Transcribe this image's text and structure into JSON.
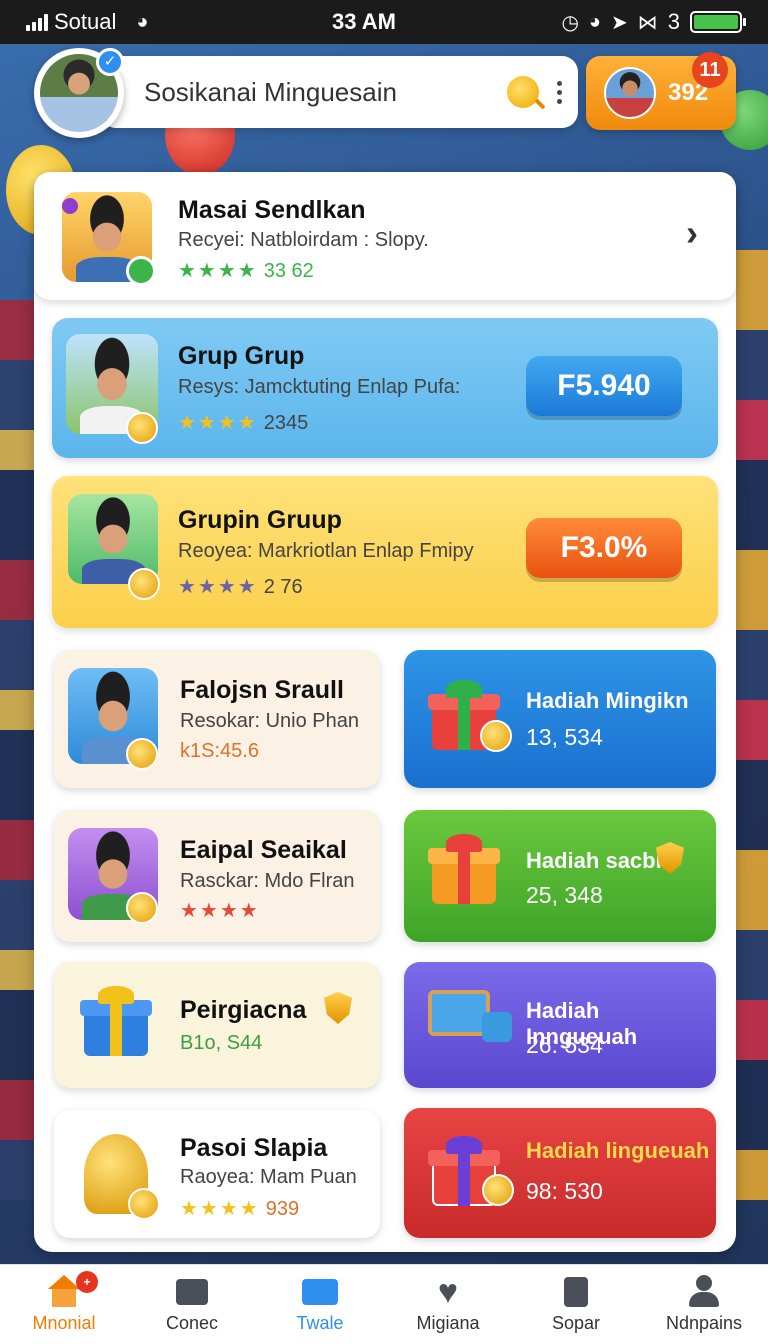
{
  "status_bar": {
    "carrier": "Sotual",
    "time": "33 AM",
    "battery_level_text": "3"
  },
  "header": {
    "search_text": "Sosikanai Minguesain",
    "coin_amount": "392",
    "notification_count": "11"
  },
  "featured": {
    "title": "Masai Sendlkan",
    "subtitle": "Recyei: Natbloirdam : Slopy.",
    "stars": "★★★★",
    "count": "33 62"
  },
  "groups": [
    {
      "title": "Grup Grup",
      "subtitle": "Resys: Jamcktuting Enlap Pufa:",
      "stars": "★★★★",
      "count": "2345",
      "price": "F5.940"
    },
    {
      "title": "Grupin Gruup",
      "subtitle": "Reoyea: Markriotlan Enlap Fmipy",
      "stars": "★★★★",
      "count": "2 76",
      "price": "F3.0%"
    }
  ],
  "players": [
    {
      "title": "Falojsn Sraull",
      "subtitle": "Resokar: Unio Phan",
      "extra": "k1S:45.6"
    },
    {
      "title": "Eaipal Seaikal",
      "subtitle": "Rasckar: Mdo Flran",
      "extra": "★★★★"
    },
    {
      "title": "Peirgiacna",
      "subtitle": "",
      "extra": "B1o, S44"
    },
    {
      "title": "Pasoi Slapia",
      "subtitle": "Raoyea: Mam Puan",
      "extra": "★★★★",
      "count": "939"
    }
  ],
  "prizes": [
    {
      "title": "Hadiah Mingikn",
      "value": "13, 534",
      "color": "#1f7fd6"
    },
    {
      "title": "Hadiah sacbi",
      "value": "25, 348",
      "color": "#4db72e"
    },
    {
      "title": "Hadiah Inngueuah",
      "value": "26: 534",
      "color": "#6a55d6"
    },
    {
      "title": "Hadiah lingueuah",
      "value": "98: 530",
      "color": "#d93636"
    }
  ],
  "nav": [
    {
      "label": "Mnonial",
      "icon": "home-icon"
    },
    {
      "label": "Conec",
      "icon": "puzzle-icon"
    },
    {
      "label": "Twale",
      "icon": "ticket-icon"
    },
    {
      "label": "Migiana",
      "icon": "heart-icon"
    },
    {
      "label": "Sopar",
      "icon": "clipboard-icon"
    },
    {
      "label": "Ndnpains",
      "icon": "profile-icon"
    }
  ],
  "nav_badge": "+"
}
